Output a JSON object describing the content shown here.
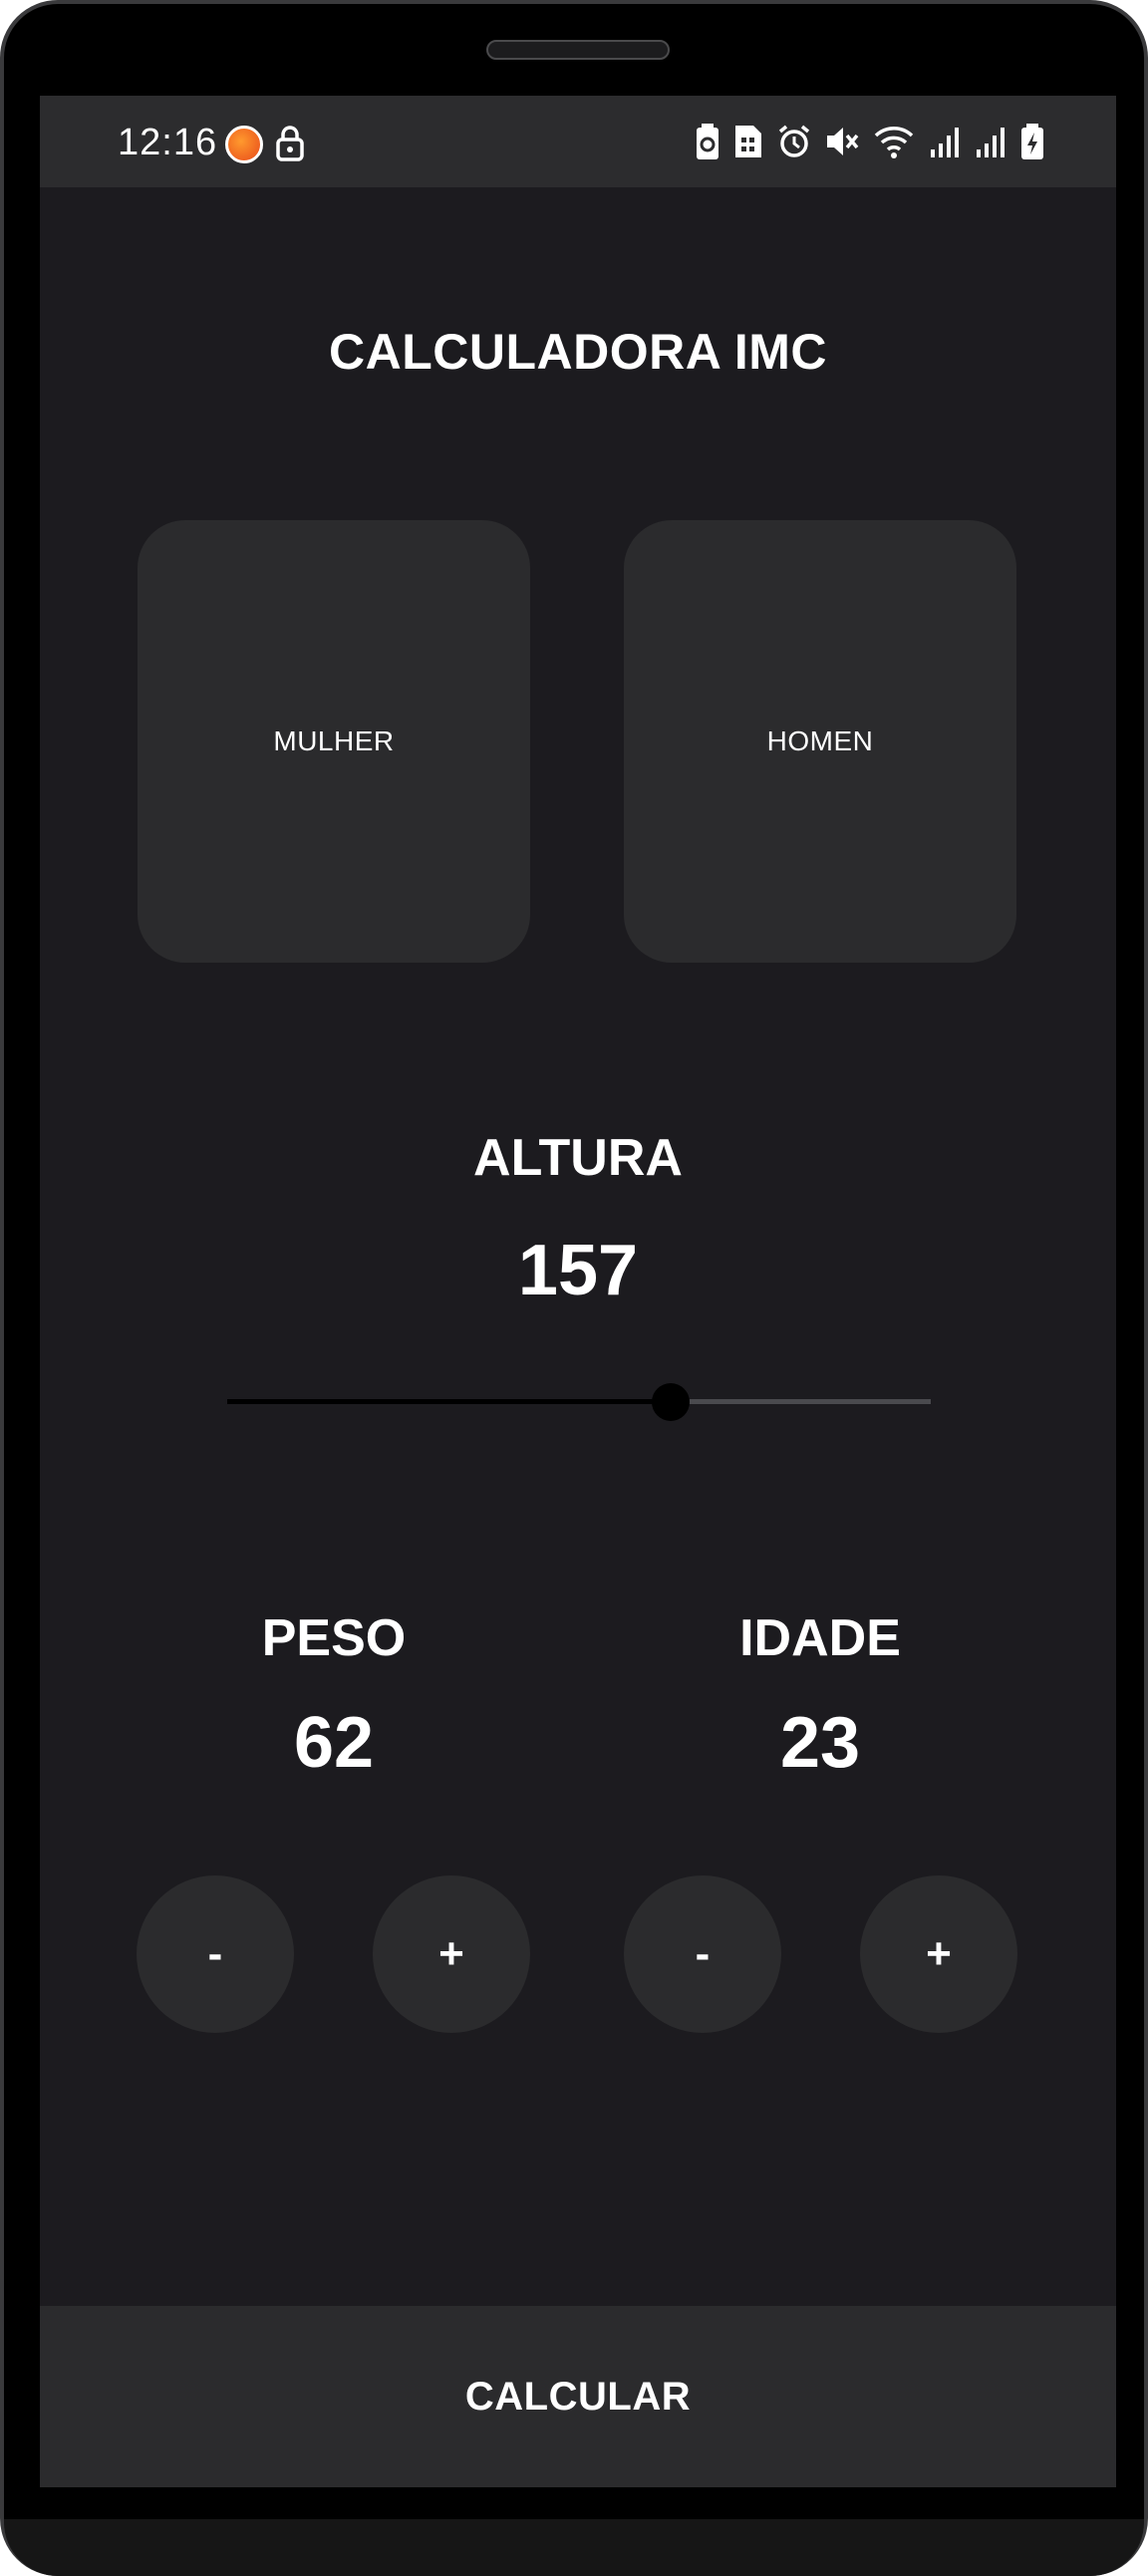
{
  "status_bar": {
    "time": "12:16",
    "icons": [
      "app-notification-icon",
      "lock-icon",
      "battery-saver-icon",
      "sim-card-icon",
      "alarm-icon",
      "mute-icon",
      "wifi-icon",
      "signal-icon",
      "signal-icon",
      "battery-charging-icon"
    ]
  },
  "app": {
    "title": "CALCULADORA IMC",
    "gender": {
      "female_label": "MULHER",
      "male_label": "HOMEN"
    },
    "height": {
      "label": "ALTURA",
      "value": "157",
      "slider_fraction": 0.63
    },
    "weight": {
      "label": "PESO",
      "value": "62",
      "minus_label": "-",
      "plus_label": "+"
    },
    "age": {
      "label": "IDADE",
      "value": "23",
      "minus_label": "-",
      "plus_label": "+"
    },
    "calculate_label": "CALCULAR"
  },
  "colors": {
    "background": "#1c1b1f",
    "card": "#2b2b2d",
    "text": "#ffffff",
    "slider_active": "#000000",
    "slider_inactive": "#4a4a4e"
  }
}
